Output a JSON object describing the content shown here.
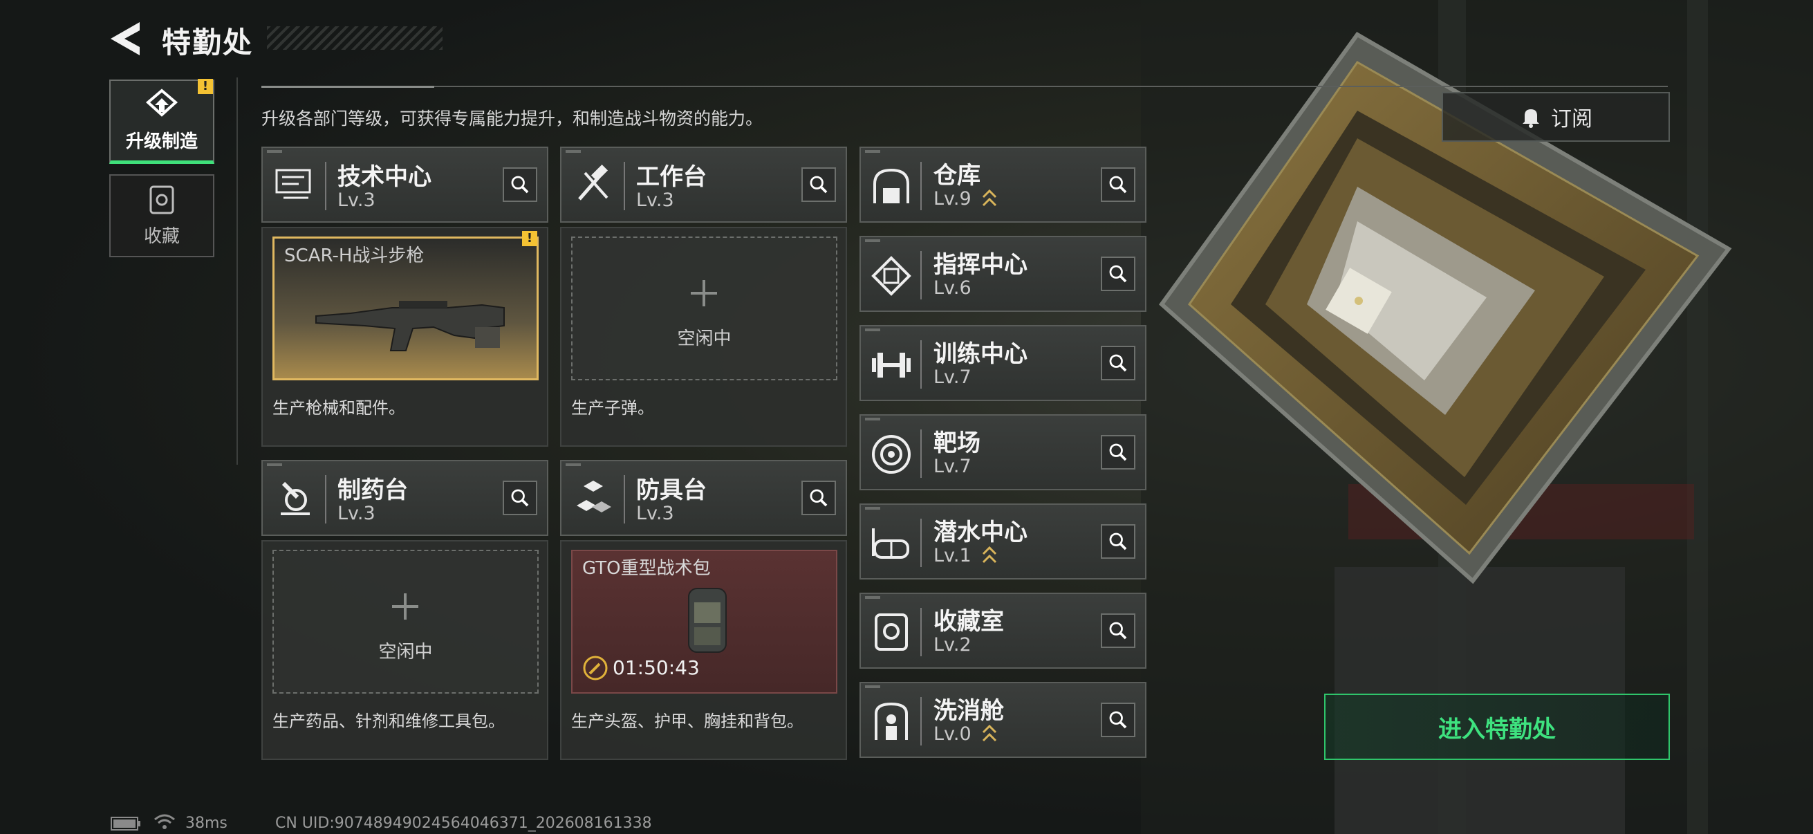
{
  "header": {
    "title": "特勤处",
    "subtitle": "升级各部门等级，可获得专属能力提升，和制造战斗物资的能力。"
  },
  "side_tabs": [
    {
      "label": "升级制造",
      "badge": "!"
    },
    {
      "label": "收藏"
    }
  ],
  "subscribe": {
    "label": "订阅"
  },
  "production": [
    {
      "name": "技术中心",
      "level": "Lv.3",
      "slot_item": "SCAR-H战斗步枪",
      "slot_badge": "!",
      "desc": "生产枪械和配件。"
    },
    {
      "name": "工作台",
      "level": "Lv.3",
      "slot_text": "空闲中",
      "desc": "生产子弹。"
    },
    {
      "name": "制药台",
      "level": "Lv.3",
      "slot_text": "空闲中",
      "desc": "生产药品、针剂和维修工具包。"
    },
    {
      "name": "防具台",
      "level": "Lv.3",
      "slot_item": "GTO重型战术包",
      "timer": "01:50:43",
      "desc": "生产头盔、护甲、胸挂和背包。"
    }
  ],
  "facilities": [
    {
      "name": "仓库",
      "level": "Lv.9",
      "upgradable": true
    },
    {
      "name": "指挥中心",
      "level": "Lv.6",
      "upgradable": false
    },
    {
      "name": "训练中心",
      "level": "Lv.7",
      "upgradable": false
    },
    {
      "name": "靶场",
      "level": "Lv.7",
      "upgradable": false
    },
    {
      "name": "潜水中心",
      "level": "Lv.1",
      "upgradable": true
    },
    {
      "name": "收藏室",
      "level": "Lv.2",
      "upgradable": false
    },
    {
      "name": "洗消舱",
      "level": "Lv.0",
      "upgradable": true
    }
  ],
  "enter_button": {
    "label": "进入特勤处"
  },
  "status_bar": {
    "ping": "38ms",
    "uid": "CN UID:90748949024564046371_202608161338"
  },
  "colors": {
    "accent_green": "#3ee27f",
    "warning_yellow": "#f4c233",
    "upgrade_gold": "#d8b45a"
  }
}
